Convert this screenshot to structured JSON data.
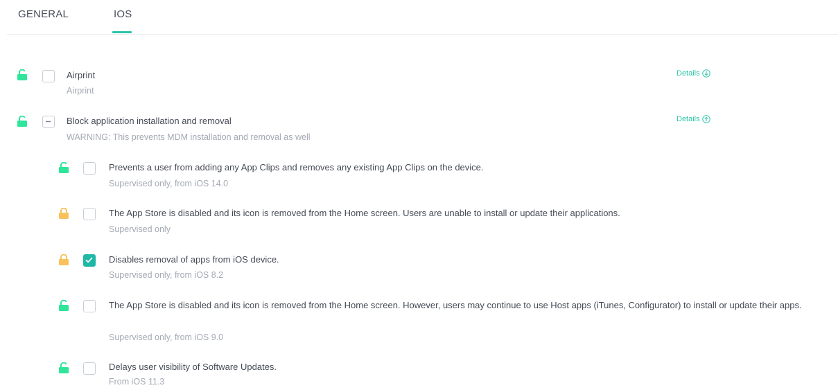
{
  "tabs": [
    {
      "label": "GENERAL"
    },
    {
      "label": "IOS"
    }
  ],
  "colors": {
    "accent": "#2cc5a8",
    "lock_open": "#2ee59a",
    "lock_closed": "#f8c15c",
    "checkbox_checked": "#1fb8a6"
  },
  "items": [
    {
      "title": "Airprint",
      "subtitle": "Airprint",
      "details": "Details",
      "details_icon": "arrow-down-circle-icon",
      "lock": "unlocked",
      "checkbox": "unchecked"
    },
    {
      "title": "Block application installation and removal",
      "subtitle": "WARNING: This prevents MDM installation and removal as well",
      "details": "Details",
      "details_icon": "arrow-up-circle-icon",
      "lock": "unlocked",
      "checkbox": "indeterminate"
    }
  ],
  "subitems": [
    {
      "title": "Prevents a user from adding any App Clips and removes any existing App Clips on the device.",
      "subtitle": "Supervised only, from iOS 14.0",
      "lock": "unlocked",
      "checkbox": "unchecked"
    },
    {
      "title": "The App Store is disabled and its icon is removed from the Home screen. Users are unable to install or update their applications.",
      "subtitle": "Supervised only",
      "lock": "locked",
      "checkbox": "unchecked"
    },
    {
      "title": "Disables removal of apps from iOS device.",
      "subtitle": "Supervised only, from iOS 8.2",
      "lock": "locked",
      "checkbox": "checked"
    },
    {
      "title": "The App Store is disabled and its icon is removed from the Home screen. However, users may continue to use Host apps (iTunes, Configurator) to install or update their apps.",
      "subtitle": "Supervised only, from iOS 9.0",
      "lock": "unlocked",
      "checkbox": "unchecked"
    },
    {
      "title": "Delays user visibility of Software Updates.",
      "subtitle": "From iOS 11.3",
      "lock": "unlocked",
      "checkbox": "unchecked"
    }
  ]
}
